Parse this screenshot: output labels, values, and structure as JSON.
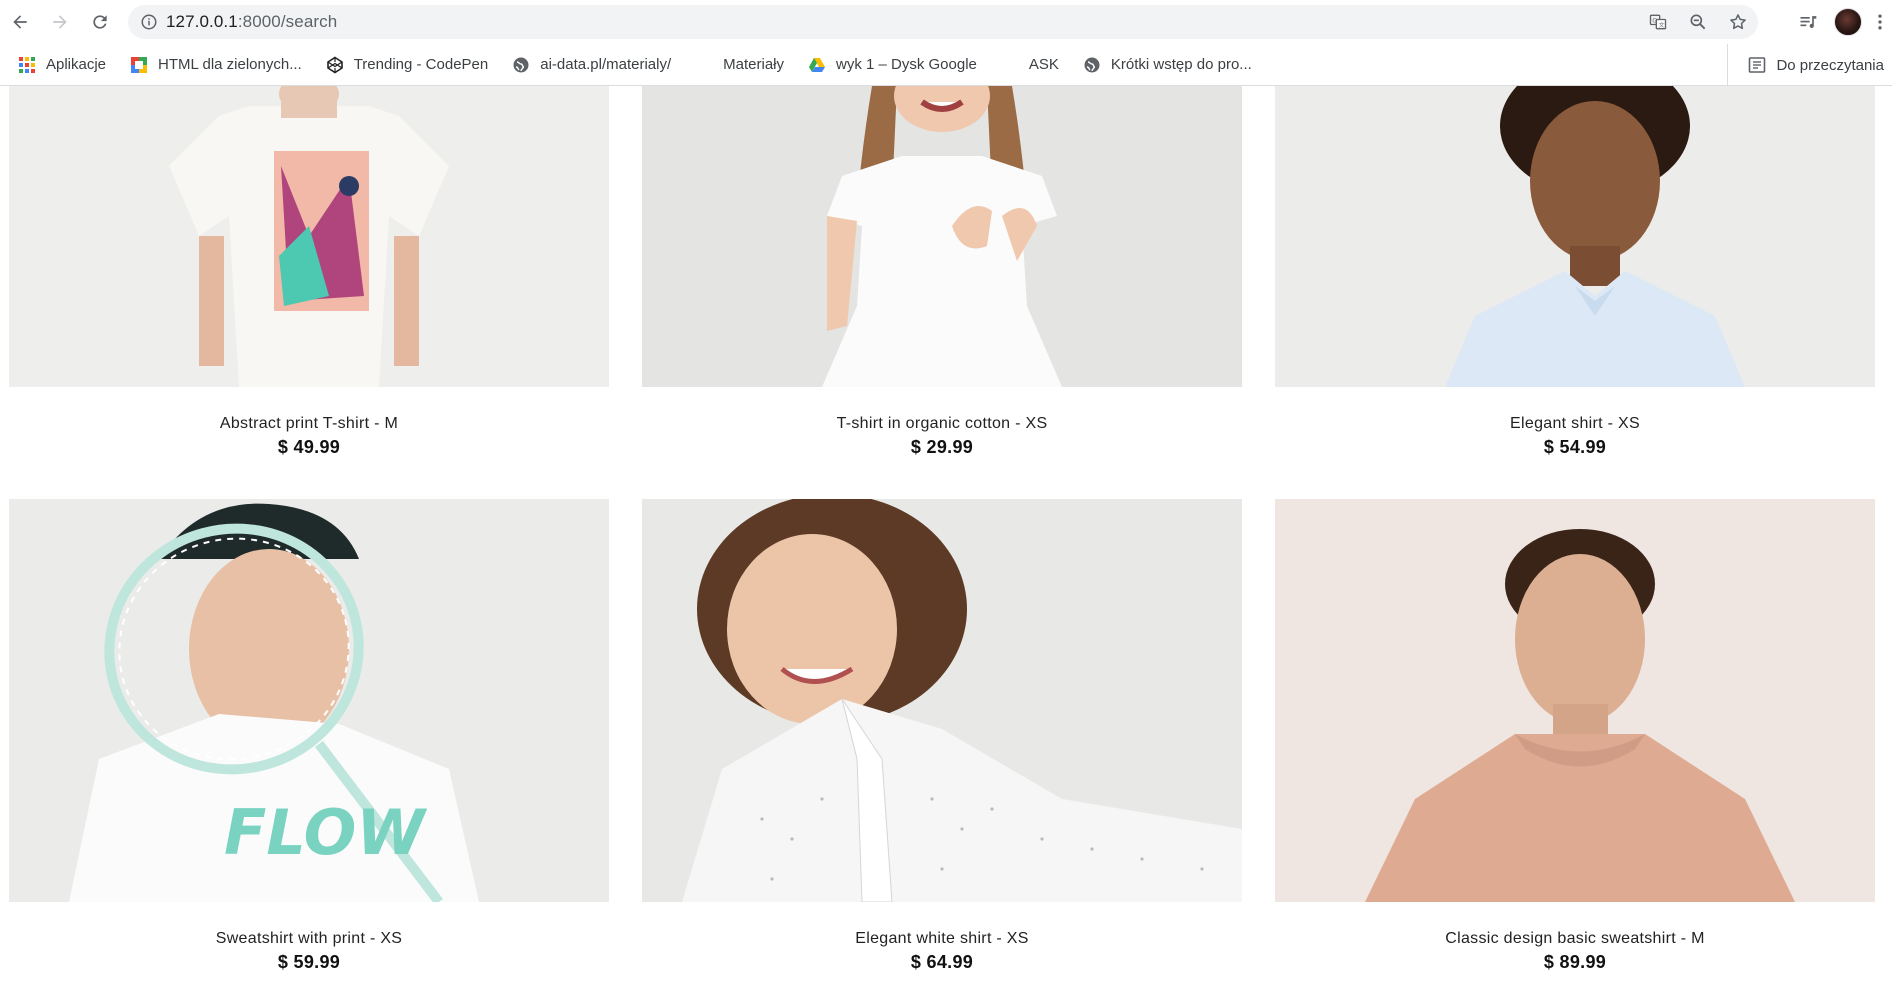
{
  "browser": {
    "url_host": "127.0.0.1",
    "url_rest": ":8000/search",
    "bookmarks": [
      {
        "label": "Aplikacje",
        "icon": "apps-grid-icon"
      },
      {
        "label": "HTML dla zielonych...",
        "icon": "site-favicon-icon"
      },
      {
        "label": "Trending - CodePen",
        "icon": "codepen-icon"
      },
      {
        "label": "ai-data.pl/materialy/",
        "icon": "globe-icon"
      },
      {
        "label": "Materiały",
        "icon": "blank-icon"
      },
      {
        "label": "wyk 1 – Dysk Google",
        "icon": "google-drive-icon"
      },
      {
        "label": "ASK",
        "icon": "blank-icon"
      },
      {
        "label": "Krótki wstęp do pro...",
        "icon": "globe-icon"
      }
    ],
    "reading_list": "Do przeczytania"
  },
  "products": [
    {
      "name": "Abstract print T-shirt - M",
      "price": "$ 49.99"
    },
    {
      "name": "T-shirt in organic cotton - XS",
      "price": "$ 29.99"
    },
    {
      "name": "Elegant shirt - XS",
      "price": "$ 54.99"
    },
    {
      "name": "Sweatshirt with print - XS",
      "price": "$ 59.99"
    },
    {
      "name": "Elegant white shirt - XS",
      "price": "$ 64.99"
    },
    {
      "name": "Classic design basic sweatshirt - M",
      "price": "$ 89.99"
    }
  ],
  "print_text": "FLOW"
}
